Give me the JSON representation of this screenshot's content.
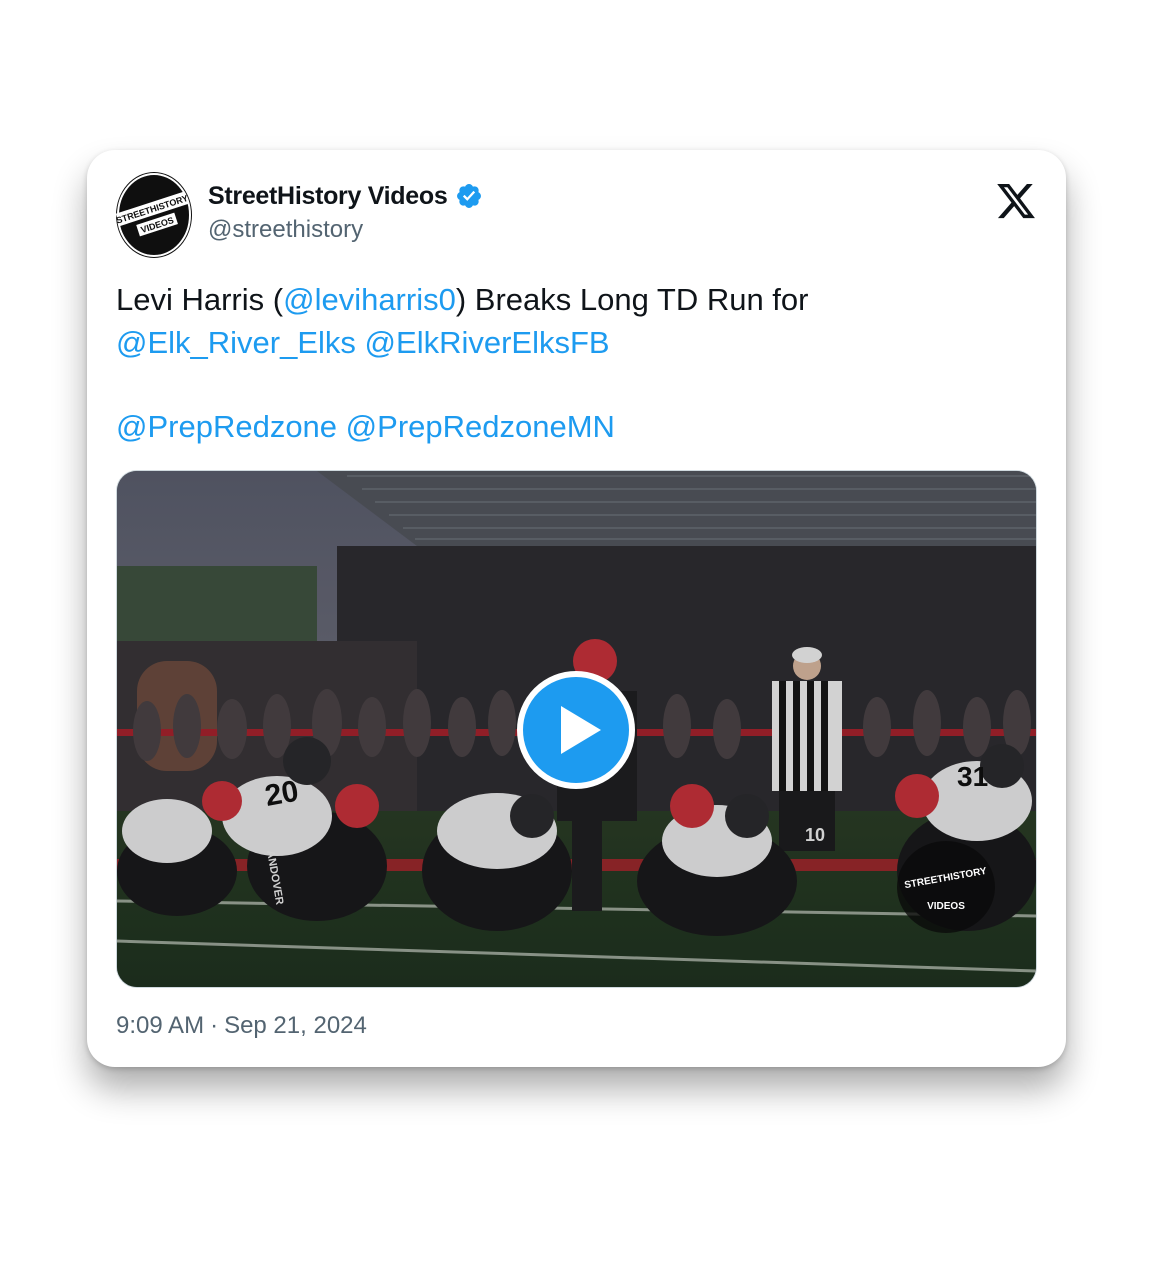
{
  "author": {
    "display_name": "StreetHistory Videos",
    "handle": "@streethistory",
    "avatar_text_top": "STREETHISTORY",
    "avatar_text_bottom": "VIDEOS"
  },
  "tweet": {
    "text_prefix": "Levi Harris (",
    "mention_1": "@leviharris0",
    "text_middle": ") Breaks Long TD Run for",
    "mention_2": "@Elk_River_Elks",
    "mention_3": "@ElkRiverElksFB",
    "mention_4": "@PrepRedzone",
    "mention_5": "@PrepRedzoneMN"
  },
  "media": {
    "type": "video",
    "watermark_top": "STREETHISTORY",
    "watermark_bottom": "VIDEOS",
    "jersey_numbers": [
      "20",
      "31",
      "10"
    ],
    "jersey_text": "ANDOVER"
  },
  "meta": {
    "time": "9:09 AM",
    "separator": "·",
    "date": "Sep 21, 2024"
  },
  "icons": {
    "verified": "verified-badge-icon",
    "platform": "x-logo-icon",
    "play": "play-icon"
  },
  "colors": {
    "accent": "#1d9bf0",
    "text": "#0f1419",
    "secondary": "#536471"
  }
}
